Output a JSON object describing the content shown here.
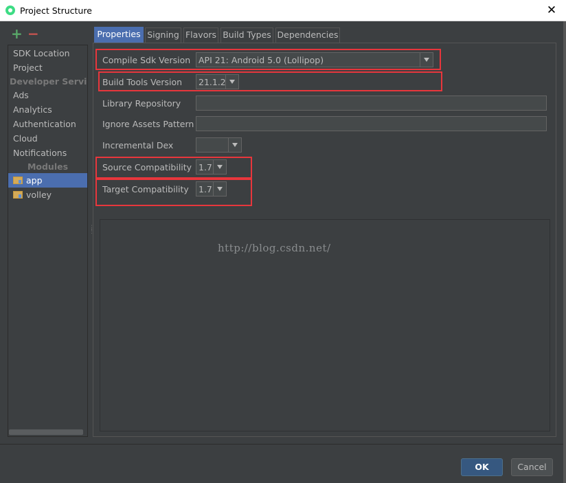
{
  "window": {
    "title": "Project Structure",
    "close_glyph": "✕",
    "close_icon": "close-icon",
    "app_icon": "android-studio-icon"
  },
  "toolbar": {
    "add_glyph": "+",
    "remove_glyph": "−"
  },
  "sidebar": {
    "items": [
      {
        "label": "SDK Location",
        "kind": "item"
      },
      {
        "label": "Project",
        "kind": "item"
      },
      {
        "label": "Developer Services",
        "kind": "group"
      },
      {
        "label": "Ads",
        "kind": "item"
      },
      {
        "label": "Analytics",
        "kind": "item"
      },
      {
        "label": "Authentication",
        "kind": "item"
      },
      {
        "label": "Cloud",
        "kind": "item"
      },
      {
        "label": "Notifications",
        "kind": "item"
      },
      {
        "label": "Modules",
        "kind": "group"
      },
      {
        "label": "app",
        "kind": "module",
        "selected": true
      },
      {
        "label": "volley",
        "kind": "module",
        "selected": false
      }
    ]
  },
  "tabs": [
    {
      "label": "Properties",
      "active": true
    },
    {
      "label": "Signing",
      "active": false
    },
    {
      "label": "Flavors",
      "active": false
    },
    {
      "label": "Build Types",
      "active": false
    },
    {
      "label": "Dependencies",
      "active": false
    }
  ],
  "form": {
    "compile_sdk": {
      "label": "Compile Sdk Version",
      "value": "API 21: Android 5.0 (Lollipop)"
    },
    "build_tools": {
      "label": "Build Tools Version",
      "value": "21.1.2"
    },
    "library_repo": {
      "label": "Library Repository",
      "value": ""
    },
    "ignore_assets": {
      "label": "Ignore Assets Pattern",
      "value": ""
    },
    "incremental_dex": {
      "label": "Incremental Dex",
      "value": ""
    },
    "source_compat": {
      "label": "Source Compatibility",
      "value": "1.7"
    },
    "target_compat": {
      "label": "Target Compatibility",
      "value": "1.7"
    }
  },
  "watermark": "http://blog.csdn.net/",
  "buttons": {
    "ok": "OK",
    "cancel": "Cancel"
  },
  "colors": {
    "accent": "#4b6eaf",
    "highlight": "#e8363c",
    "add": "#59a869",
    "remove": "#c75450"
  }
}
